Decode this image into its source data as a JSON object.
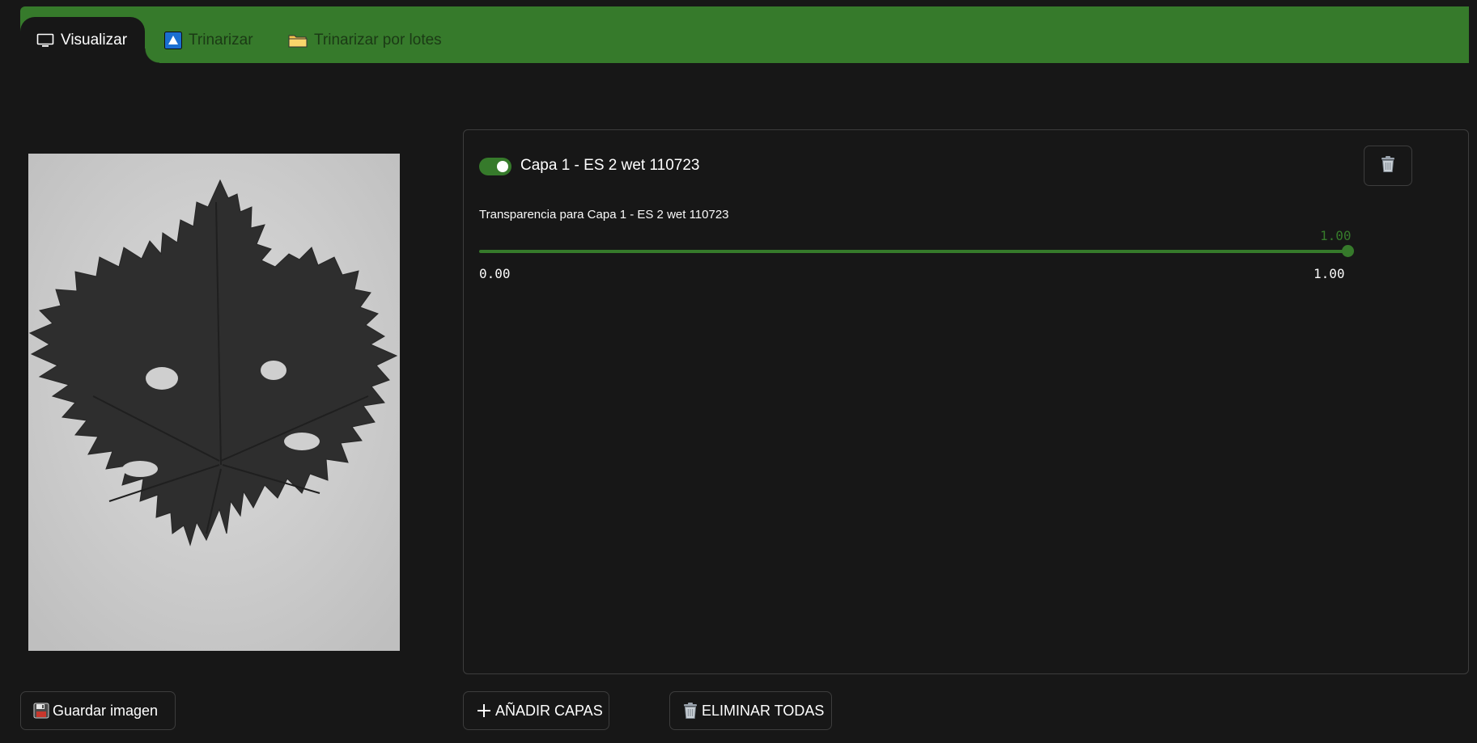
{
  "tabs": [
    {
      "label": "Visualizar",
      "icon": "monitor-icon",
      "active": true
    },
    {
      "label": "Trinarizar",
      "icon": "triangle-icon",
      "active": false
    },
    {
      "label": "Trinarizar por lotes",
      "icon": "folder-icon",
      "active": false
    }
  ],
  "layer": {
    "name": "Capa 1 - ES 2 wet 110723",
    "visible": true,
    "opacity_label": "Transparencia para Capa 1 - ES 2 wet 110723",
    "opacity_value": "1.00",
    "min": "0.00",
    "max": "1.00"
  },
  "buttons": {
    "save_image": "Guardar imagen",
    "add_layers": "AÑADIR CAPAS",
    "delete_all": "ELIMINAR TODAS"
  },
  "colors": {
    "accent": "#367a2b",
    "background": "#171717",
    "border": "#3d3d3d"
  }
}
